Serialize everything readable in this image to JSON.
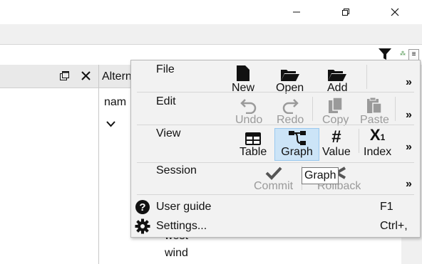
{
  "window": {
    "controls": [
      "minimize-icon",
      "maximize-icon",
      "close-icon"
    ]
  },
  "left_dock": {
    "buttons": [
      "float-icon",
      "close-icon"
    ]
  },
  "right_dock": {
    "title": "Altern",
    "tree_label": "nam",
    "items": [
      "west",
      "wind"
    ]
  },
  "popup": {
    "sections": [
      {
        "label": "File",
        "tools": [
          {
            "label": "New",
            "icon": "new-file-icon"
          },
          {
            "label": "Open",
            "icon": "open-folder-icon"
          },
          {
            "label": "Add",
            "icon": "add-folder-icon"
          }
        ]
      },
      {
        "label": "Edit",
        "tools": [
          {
            "label": "Undo",
            "icon": "undo-icon"
          },
          {
            "label": "Redo",
            "icon": "redo-icon"
          },
          {
            "label": "Copy",
            "icon": "copy-icon"
          },
          {
            "label": "Paste",
            "icon": "paste-icon"
          }
        ]
      },
      {
        "label": "View",
        "tools": [
          {
            "label": "Table",
            "icon": "table-icon"
          },
          {
            "label": "Graph",
            "icon": "graph-icon",
            "checked": true
          },
          {
            "label": "Value",
            "icon": "hash-icon"
          },
          {
            "label": "Index",
            "icon": "index-icon"
          }
        ]
      },
      {
        "label": "Session",
        "tools": [
          {
            "label": "Commit",
            "icon": "check-icon"
          },
          {
            "label": "Rollback",
            "icon": "rollback-icon"
          }
        ]
      }
    ],
    "overflow": "»",
    "items": [
      {
        "label": "User guide",
        "shortcut": "F1",
        "icon": "help-icon"
      },
      {
        "label": "Settings...",
        "shortcut": "Ctrl+,",
        "icon": "gear-icon"
      }
    ]
  },
  "tooltip": {
    "text": "Graph"
  }
}
